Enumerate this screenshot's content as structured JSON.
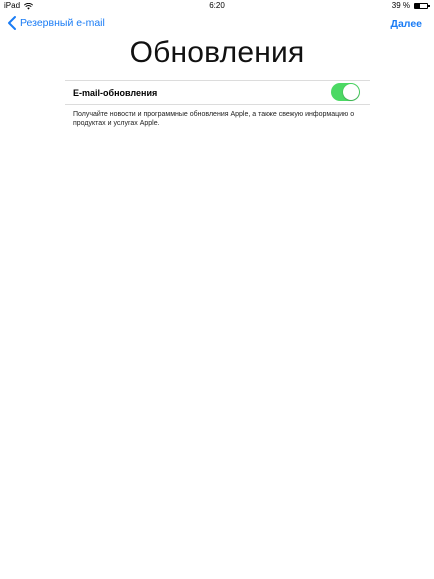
{
  "status_bar": {
    "device": "iPad",
    "time": "6:20",
    "battery_text": "39 %",
    "battery_level": 0.39
  },
  "nav": {
    "back_label": "Резервный e-mail",
    "next_label": "Далее"
  },
  "page": {
    "title": "Обновления"
  },
  "setting": {
    "label": "E-mail-обновления",
    "enabled": true,
    "description": "Получайте новости и программные обновления Apple, а также свежую информацию о продуктах и услугах Apple."
  },
  "colors": {
    "accent": "#1a7cf5",
    "toggle_on": "#4cd964"
  }
}
